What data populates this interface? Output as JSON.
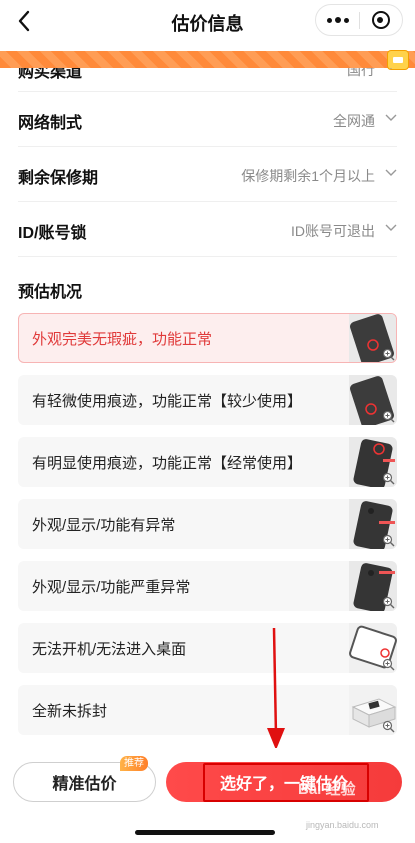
{
  "header": {
    "title": "估价信息"
  },
  "rows": [
    {
      "label": "购买渠道",
      "value": "国行"
    },
    {
      "label": "网络制式",
      "value": "全网通"
    },
    {
      "label": "剩余保修期",
      "value": "保修期剩余1个月以上"
    },
    {
      "label": "ID/账号锁",
      "value": "ID账号可退出"
    }
  ],
  "section": {
    "title": "预估机况"
  },
  "options": [
    {
      "label": "外观完美无瑕疵，功能正常",
      "selected": true
    },
    {
      "label": "有轻微使用痕迹，功能正常【较少使用】",
      "selected": false
    },
    {
      "label": "有明显使用痕迹，功能正常【经常使用】",
      "selected": false
    },
    {
      "label": "外观/显示/功能有异常",
      "selected": false
    },
    {
      "label": "外观/显示/功能严重异常",
      "selected": false
    },
    {
      "label": "无法开机/无法进入桌面",
      "selected": false
    },
    {
      "label": "全新未拆封",
      "selected": false
    }
  ],
  "bottom": {
    "precise_label": "精准估价",
    "recommend_tag": "推荐",
    "estimate_label": "选好了，一键估价"
  },
  "watermark": {
    "main": "Bai 经验",
    "sub": "jingyan.baidu.com"
  },
  "colors": {
    "accent_red": "#f53b3b",
    "selected_bg": "#fdeeee",
    "promo_orange": "#ff8a3a"
  }
}
